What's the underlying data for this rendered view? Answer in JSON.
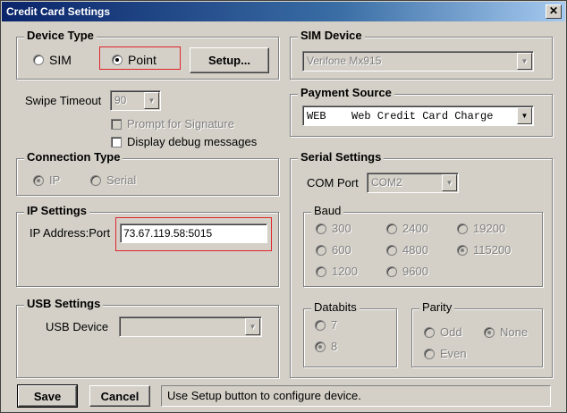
{
  "window": {
    "title": "Credit Card Settings",
    "close_glyph": "✕"
  },
  "device_type": {
    "legend": "Device Type",
    "sim_label": "SIM",
    "point_label": "Point",
    "selected": "Point",
    "setup_button": "Setup..."
  },
  "swipe": {
    "label": "Swipe Timeout",
    "value": "90"
  },
  "options": {
    "prompt_signature": "Prompt for Signature",
    "debug_messages": "Display debug messages"
  },
  "connection_type": {
    "legend": "Connection Type",
    "ip_label": "IP",
    "serial_label": "Serial",
    "selected": "IP"
  },
  "ip_settings": {
    "legend": "IP Settings",
    "label": "IP Address:Port",
    "value": "73.67.119.58:5015"
  },
  "usb_settings": {
    "legend": "USB Settings",
    "label": "USB Device",
    "value": ""
  },
  "sim_device": {
    "legend": "SIM Device",
    "value": "Verifone Mx915"
  },
  "payment_source": {
    "legend": "Payment Source",
    "code": "WEB",
    "name": "Web Credit Card Charge"
  },
  "serial_settings": {
    "legend": "Serial Settings",
    "com_label": "COM Port",
    "com_value": "COM2",
    "baud": {
      "legend": "Baud",
      "rates": [
        "300",
        "2400",
        "19200",
        "600",
        "4800",
        "115200",
        "1200",
        "9600"
      ],
      "selected": "115200"
    },
    "databits": {
      "legend": "Databits",
      "opt_7": "7",
      "opt_8": "8",
      "selected": "8"
    },
    "parity": {
      "legend": "Parity",
      "odd": "Odd",
      "none": "None",
      "even": "Even",
      "selected": "None"
    }
  },
  "footer": {
    "save_label": "Save",
    "cancel_label": "Cancel",
    "status_text": "Use Setup button to configure device."
  },
  "colors": {
    "titlebar": "#0a246a",
    "dialog_bg": "#d4d0c8",
    "highlight_box": "#e0242a"
  }
}
